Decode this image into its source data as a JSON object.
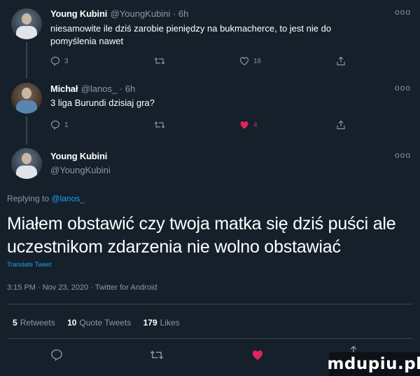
{
  "tweets": [
    {
      "name": "Young Kubini",
      "handle": "@YoungKubini · 6h",
      "text": "niesamowite ile dziś zarobie pieniędzy na bukmacherce, to jest nie do pomyślenia nawet",
      "reply_count": "3",
      "retweet_count": "",
      "like_count": "16"
    },
    {
      "name": "Michał",
      "handle": "@lanos_ · 6h",
      "text": "3 liga Burundi dzisiaj gra?",
      "reply_count": "1",
      "retweet_count": "",
      "like_count": "4"
    }
  ],
  "main": {
    "name": "Young Kubini",
    "handle": "@YoungKubini",
    "replying_prefix": "Replying to",
    "replying_handle": "@lanos_",
    "text": "Miałem obstawić czy twoja matka się dziś puści ale uczestnikom zdarzenia nie wolno obstawiać",
    "translate": "Translate Tweet",
    "meta": "3:15 PM · Nov 23, 2020 · Twitter for Android",
    "retweets_count": "5",
    "retweets_label": "Retweets",
    "quotes_count": "10",
    "quotes_label": "Quote Tweets",
    "likes_count": "179",
    "likes_label": "Likes"
  },
  "watermark": "mdupiu.pl",
  "colors": {
    "background": "#15202b",
    "secondary_text": "#8899a6",
    "link": "#1da1f2",
    "like": "#e0245e",
    "divider": "#38444d"
  },
  "icons": [
    "reply-icon",
    "retweet-icon",
    "like-icon",
    "share-icon",
    "more-icon"
  ]
}
